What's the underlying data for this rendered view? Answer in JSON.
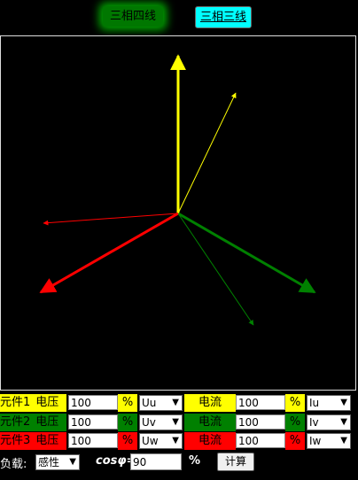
{
  "modes": {
    "four_wire": "三相四线",
    "three_wire": "三相三线"
  },
  "rows": [
    {
      "element": "元件1",
      "voltage_label": "电压",
      "voltage_value": "100",
      "pct": "%",
      "voltage_sel": "Uu",
      "current_label": "电流",
      "current_value": "100",
      "pct2": "%",
      "current_sel": "Iu",
      "color": "#ffff00"
    },
    {
      "element": "元件2",
      "voltage_label": "电压",
      "voltage_value": "100",
      "pct": "%",
      "voltage_sel": "Uv",
      "current_label": "电流",
      "current_value": "100",
      "pct2": "%",
      "current_sel": "Iv",
      "color": "#008000"
    },
    {
      "element": "元件3",
      "voltage_label": "电压",
      "voltage_value": "100",
      "pct": "%",
      "voltage_sel": "Uw",
      "current_label": "电流",
      "current_value": "100",
      "pct2": "%",
      "current_sel": "Iw",
      "color": "#ff0000"
    }
  ],
  "load": {
    "label": "负载:",
    "type": "感性",
    "cos_label": "cosφ=",
    "cos_value": "90",
    "pct": "%",
    "calc": "计算"
  },
  "colors": {
    "u": "#ffff00",
    "v": "#008000",
    "w": "#ff0000"
  }
}
